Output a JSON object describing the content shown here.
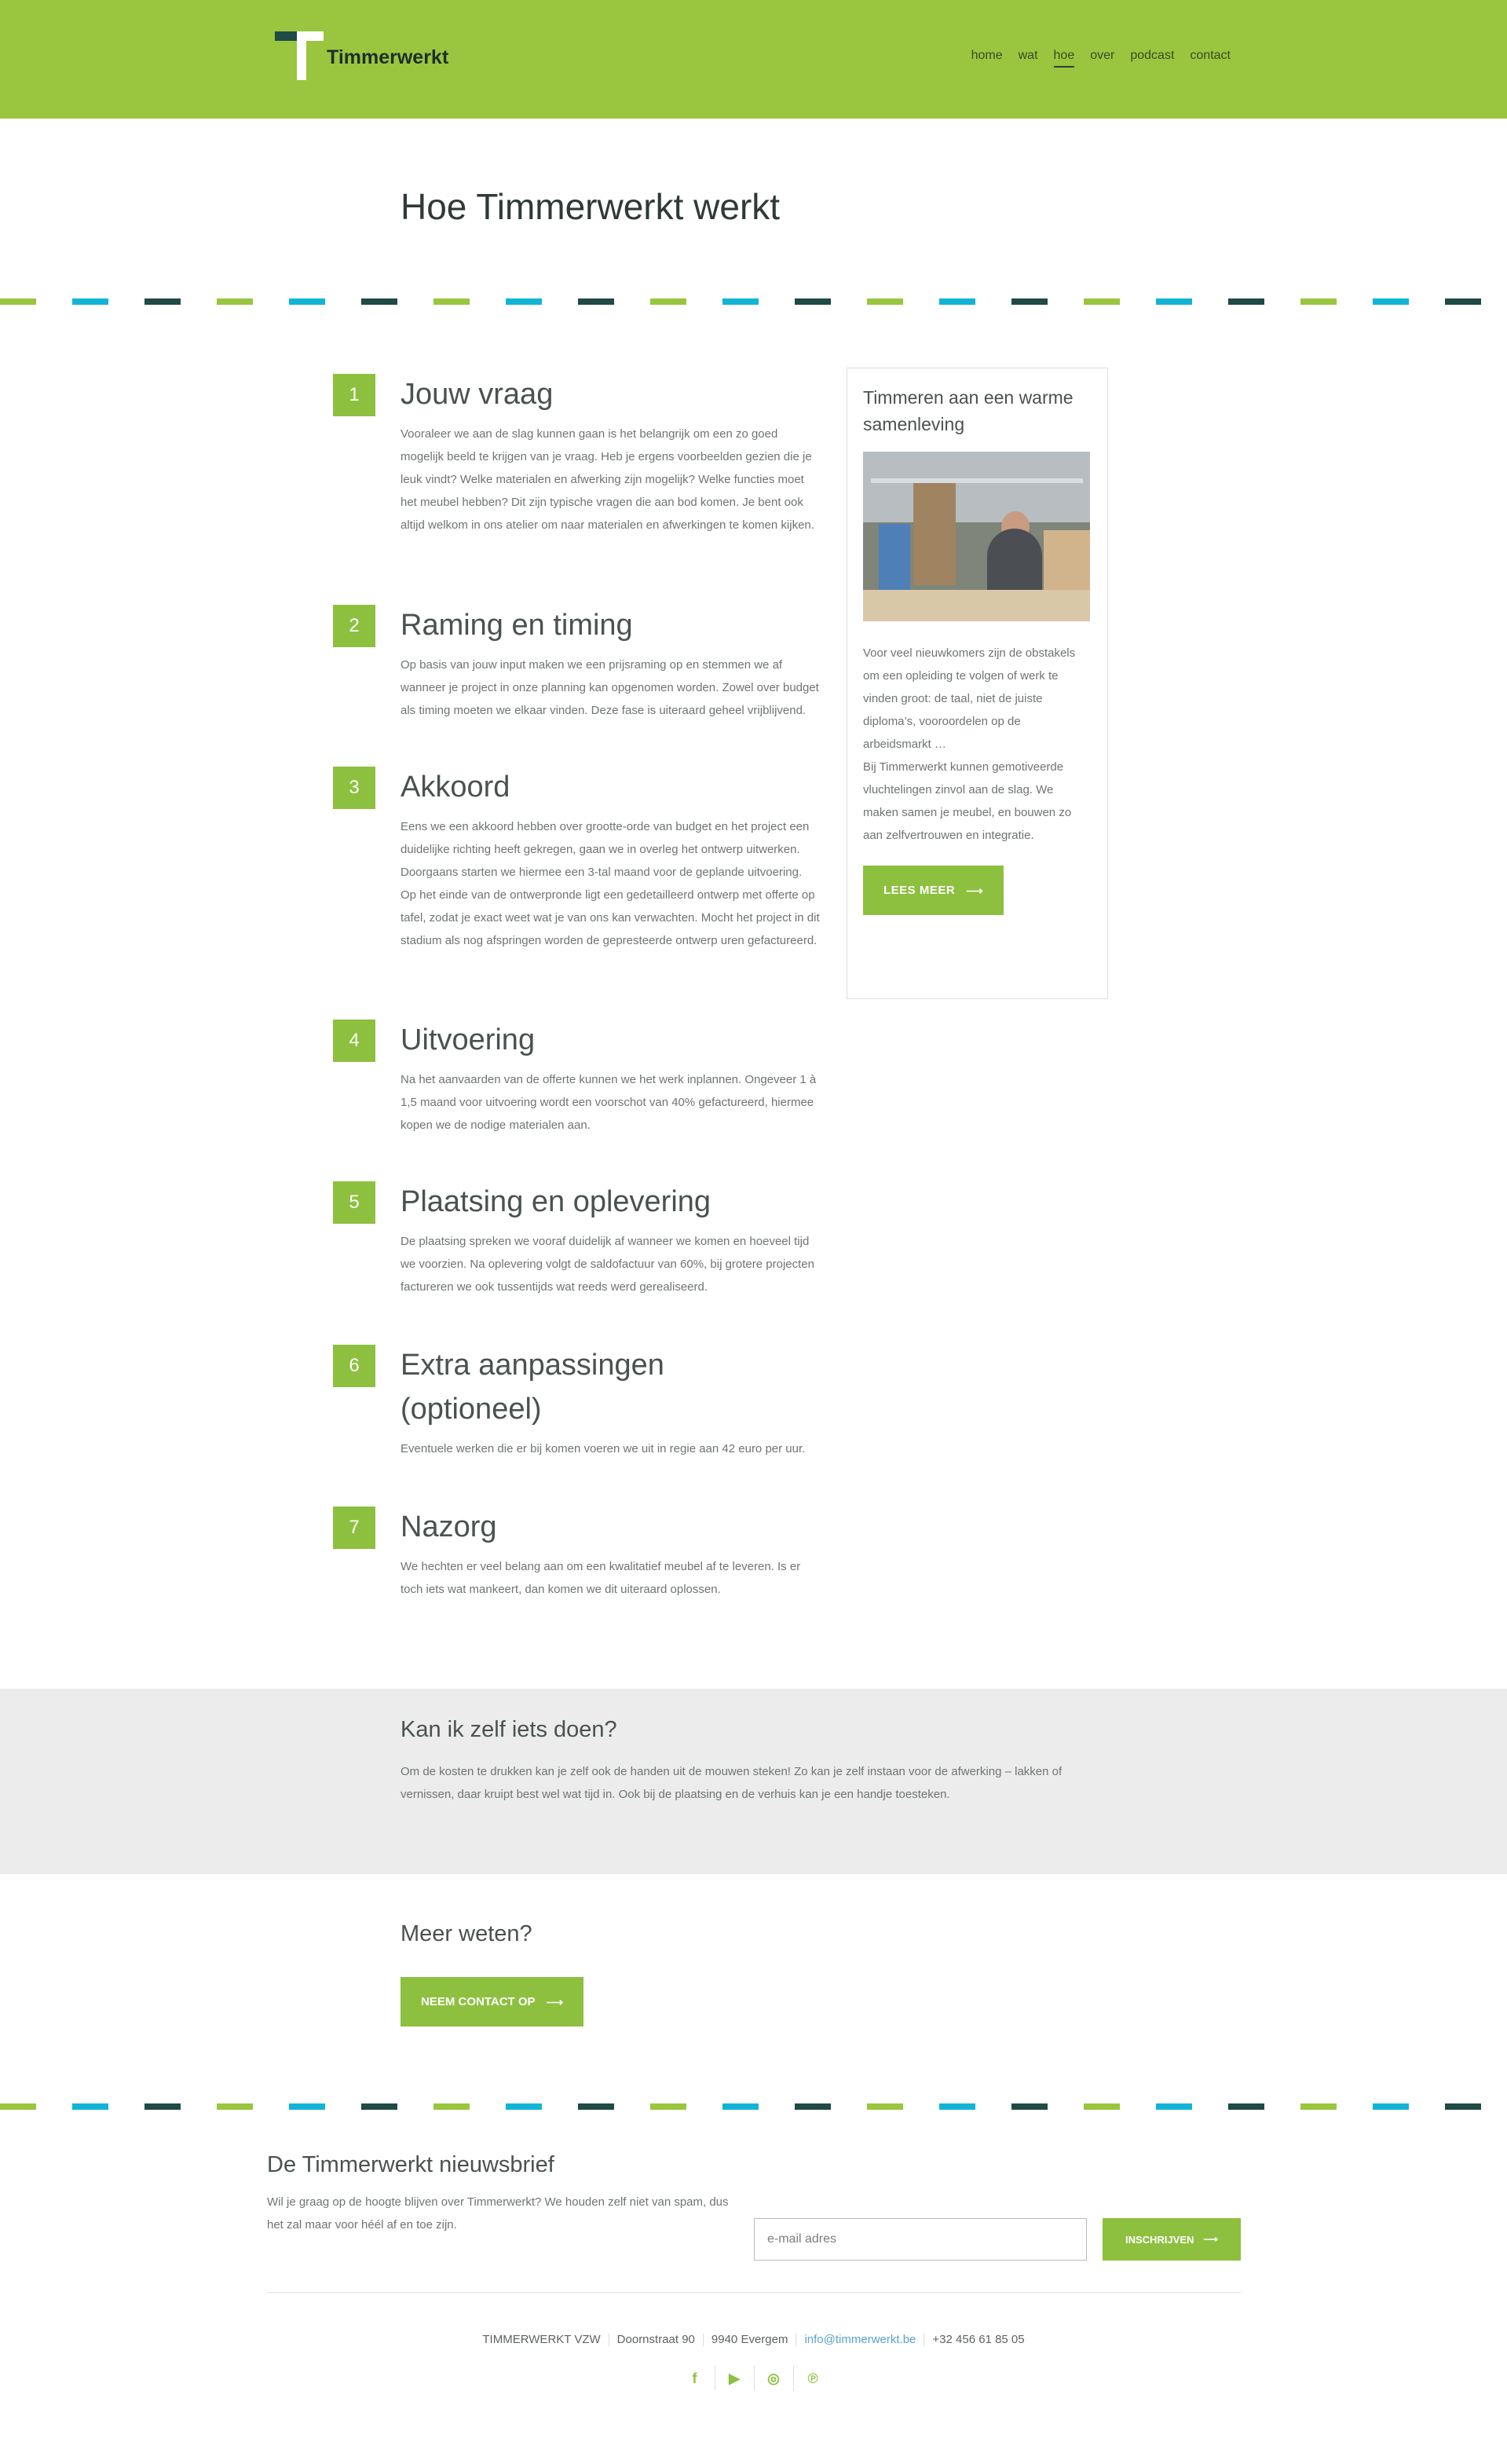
{
  "header": {
    "brand": "Timmerwerkt",
    "nav": [
      {
        "label": "home"
      },
      {
        "label": "wat"
      },
      {
        "label": "hoe",
        "active": true
      },
      {
        "label": "over"
      },
      {
        "label": "podcast"
      },
      {
        "label": "contact"
      }
    ]
  },
  "page_title": "Hoe Timmerwerkt werkt",
  "divider_colors": [
    "#99c63e",
    "#12b4d6",
    "#1f4a45"
  ],
  "steps": [
    {
      "number": "1",
      "title": "Jouw vraag",
      "text": "Vooraleer we aan de slag kunnen gaan is het belangrijk om een zo goed mogelijk beeld te krijgen van je vraag. Heb je ergens voorbeelden gezien die je leuk vindt? Welke materialen en afwerking zijn mogelijk? Welke functies moet het meubel hebben? Dit zijn typische vragen die aan bod komen. Je bent ook altijd welkom in ons atelier om naar materialen en afwerkingen te komen kijken."
    },
    {
      "number": "2",
      "title": "Raming en timing",
      "text": "Op basis van jouw input maken we een prijsraming op en stemmen we af wanneer je project in onze planning kan opgenomen worden. Zowel over budget als timing moeten we elkaar vinden. Deze fase is uiteraard geheel vrijblijvend."
    },
    {
      "number": "3",
      "title": "Akkoord",
      "text": "Eens we een akkoord hebben over grootte-orde van budget en het project een duidelijke richting heeft gekregen, gaan we in overleg het ontwerp uitwerken. Doorgaans starten we hiermee een 3-tal maand voor de geplande uitvoering. Op het einde van de ontwerpronde ligt een gedetailleerd ontwerp met offerte op tafel, zodat je exact weet wat je van ons kan verwachten. Mocht het project in dit stadium als nog afspringen worden de gepresteerde ontwerp uren gefactureerd."
    },
    {
      "number": "4",
      "title": "Uitvoering",
      "text": "Na het aanvaarden van de offerte kunnen we het werk inplannen. Ongeveer 1 à 1,5 maand voor uitvoering wordt een voorschot van 40% gefactureerd, hiermee kopen we de nodige materialen aan."
    },
    {
      "number": "5",
      "title": "Plaatsing en oplevering",
      "text": "De plaatsing spreken we vooraf duidelijk af wanneer we komen en hoeveel tijd we voorzien.  Na oplevering volgt de saldofactuur van 60%, bij grotere projecten factureren we ook tussentijds wat reeds werd gerealiseerd."
    },
    {
      "number": "6",
      "title": "Extra aanpassingen (optioneel)",
      "text": "Eventuele werken die er bij komen voeren we uit in regie aan 42 euro per uur."
    },
    {
      "number": "7",
      "title": "Nazorg",
      "text": "We hechten er veel belang aan om een kwalitatief meubel af te leveren. Is er toch iets wat mankeert, dan komen we dit uiteraard oplossen."
    }
  ],
  "sidebar": {
    "title": "Timmeren aan een warme samenleving",
    "text_1": "Voor veel nieuwkomers zijn de obstakels om een opleiding te volgen of werk te vinden groot: de taal, niet de juiste diploma’s, vooroordelen op de arbeidsmarkt …",
    "text_2": "Bij Timmerwerkt kunnen gemotiveerde vluchtelingen zinvol aan de slag. We maken samen je meubel, en bouwen zo aan zelfvertrouwen en integratie.",
    "button": "LEES MEER"
  },
  "diy": {
    "heading": "Kan ik zelf iets doen?",
    "text": "Om de kosten te drukken kan je zelf ook de handen uit de mouwen steken! Zo kan je zelf instaan voor de afwerking – lakken of vernissen, daar kruipt best wel wat tijd in. Ook bij de plaatsing en de verhuis kan je een handje toesteken."
  },
  "more": {
    "heading": "Meer weten?",
    "button": "NEEM CONTACT OP"
  },
  "newsletter": {
    "title": "De Timmerwerkt nieuwsbrief",
    "text": "Wil je graag op de hoogte blijven over Timmerwerkt? We houden zelf niet van spam, dus het zal maar voor héél af en toe zijn.",
    "placeholder": "e-mail adres",
    "button": "INSCHRIJVEN"
  },
  "footer": {
    "org": "TIMMERWERKT VZW",
    "street": "Doornstraat 90",
    "city": "9940 Evergem",
    "email": "info@timmerwerkt.be",
    "phone": "+32 456 61 85 05",
    "social": [
      "facebook-icon",
      "youtube-icon",
      "instagram-icon",
      "pinterest-icon"
    ]
  },
  "icons": {
    "arrow": "⟶",
    "facebook": "f",
    "youtube": "▶",
    "instagram": "◎",
    "pinterest": "℗"
  }
}
